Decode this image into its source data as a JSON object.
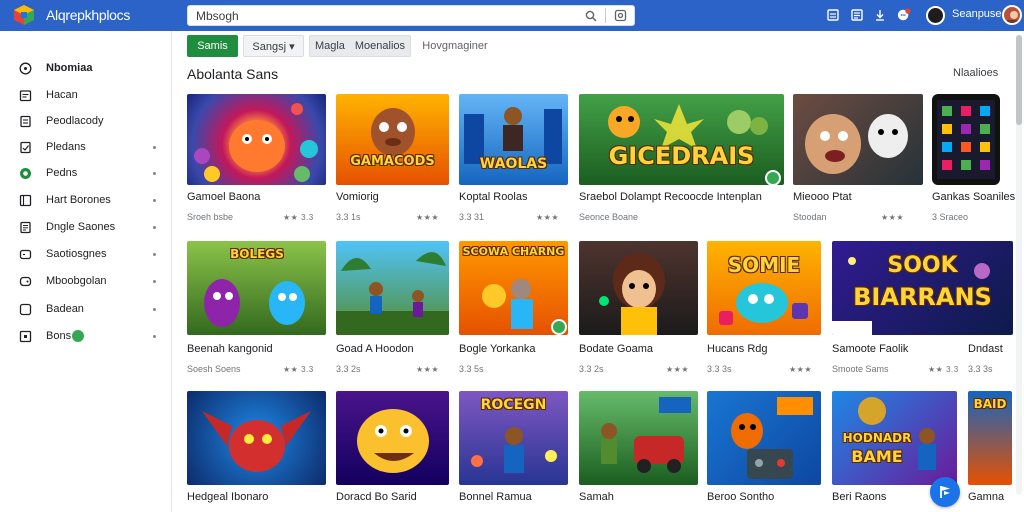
{
  "app": {
    "title": "Alqrepkhplocs"
  },
  "search": {
    "value": "Mbsogh",
    "placeholder": ""
  },
  "user": {
    "name": "Seanpuse"
  },
  "sidebar": {
    "items": [
      {
        "label": "Nbomiaa",
        "icon": "compass-icon",
        "active": true
      },
      {
        "label": "Hacan",
        "icon": "calendar-icon"
      },
      {
        "label": "Peodlacody",
        "icon": "document-icon"
      },
      {
        "label": "Pledans",
        "icon": "bookmark-icon",
        "dot": true
      },
      {
        "label": "Pedns",
        "icon": "circle-icon",
        "dot": true
      },
      {
        "label": "Hart Borones",
        "icon": "trending-icon",
        "dot": true
      },
      {
        "label": "Dngle Saones",
        "icon": "page-icon",
        "dot": true
      },
      {
        "label": "Saotiosgnes",
        "icon": "gamepad-icon",
        "dot": true
      },
      {
        "label": "Mboobgolan",
        "icon": "controller-icon",
        "dot": true
      },
      {
        "label": "Badean",
        "icon": "square-icon",
        "dot": true
      },
      {
        "label": "Bons",
        "icon": "puzzle-icon",
        "dot": true,
        "badge": true
      }
    ]
  },
  "filters": {
    "primary": "Samis",
    "sort": "Sangsj ▾",
    "group_a": "Magla",
    "group_b": "Moenalios",
    "text": "Hovgmaginer"
  },
  "section": {
    "title": "Abolanta Sans",
    "more": "Nlaalioes"
  },
  "cards_row1": [
    {
      "title": "Gamoel Baona",
      "sub": "Sroeh bsbe",
      "rating": "★★ 3.3"
    },
    {
      "title": "Vomiorig",
      "sub": "3.3 1s",
      "rating": "★★★"
    },
    {
      "title": "Koptal Roolas",
      "sub": "3.3 31",
      "rating": "★★★"
    },
    {
      "title": "Sraebol Dolampt Recoocde Intenplan",
      "sub": "Seonce Boane",
      "rating": ""
    },
    {
      "title": "Mieooo Ptat",
      "sub": "Stoodan",
      "rating": "★★★"
    },
    {
      "title": "Gankas Soaniles",
      "sub": "3 Sraceo",
      "rating": ""
    }
  ],
  "cards_row2": [
    {
      "title": "Beenah kangonid",
      "sub": "Soesh Soens",
      "rating": "★★ 3.3"
    },
    {
      "title": "Goad A Hoodon",
      "sub": "3.3 2s",
      "rating": "★★★"
    },
    {
      "title": "Bogle Yorkanka",
      "sub": "3.3 5s",
      "rating": ""
    },
    {
      "title": "Bodate Goama",
      "sub": "3.3 2s",
      "rating": "★★★"
    },
    {
      "title": "Hucans Rdg",
      "sub": "3.3 3s",
      "rating": "★★★"
    },
    {
      "title": "Samoote Faolik",
      "sub": "Smoote Sams",
      "rating": "★★ 3.3"
    },
    {
      "title": "Dndast",
      "sub": "3.3 3s",
      "rating": ""
    }
  ],
  "cards_row3": [
    {
      "title": "Hedgeal Ibonaro"
    },
    {
      "title": "Doracd Bo Sarid"
    },
    {
      "title": "Bonnel Ramua"
    },
    {
      "title": "Samah"
    },
    {
      "title": "Beroo Sontho"
    },
    {
      "title": "Beri Raons"
    },
    {
      "title": "Gamna"
    }
  ],
  "art": {
    "a2": "GAMACODS",
    "a3": "WAOLAS",
    "a4": "GICEDRAIS",
    "b3": "SCOWA CHARNG",
    "b5": "SOMIE",
    "b6_1": "SOOK",
    "b6_2": "BIARRANS",
    "b1": "BOLEGS",
    "c3": "ROCEGN",
    "c6_1": "HODNADR",
    "c6_2": "BAME",
    "c7": "BAID"
  },
  "colors": {
    "topbar": "#2b63c9",
    "primary_chip": "#1e8e3e",
    "badge": "#34a853",
    "fab": "#1a73e8"
  }
}
